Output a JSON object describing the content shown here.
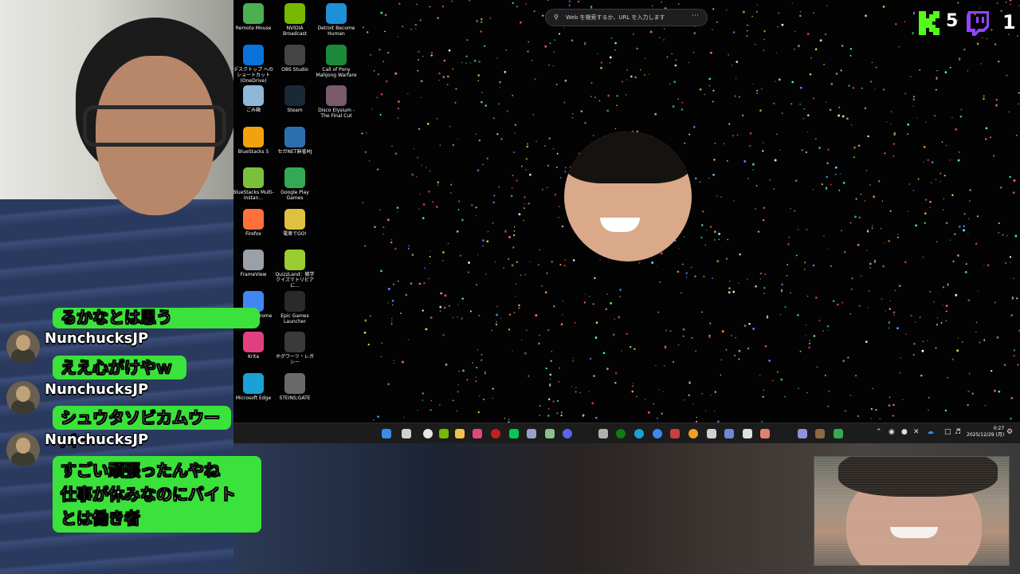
{
  "desktop": {
    "search_placeholder": "Web を検索するか、URL を入力します",
    "icons": [
      {
        "label": "Remote Mouse",
        "color": "#4caf50"
      },
      {
        "label": "NVIDIA Broadcast",
        "color": "#76b900"
      },
      {
        "label": "Detroit Become Human",
        "color": "#1f8fd6"
      },
      {
        "label": "デスクトップ への ショートカット (OneDrive)",
        "color": "#0a73d9"
      },
      {
        "label": "OBS Studio",
        "color": "#444444"
      },
      {
        "label": "Call of Pony Mahjong Warfare",
        "color": "#1a8a3a"
      },
      {
        "label": "ごみ箱",
        "color": "#8fb7d8"
      },
      {
        "label": "Steam",
        "color": "#1b2838"
      },
      {
        "label": "Disco Elysium - The Final Cut",
        "color": "#7a5a6a"
      },
      {
        "label": "BlueStacks 5",
        "color": "#f2a20f"
      },
      {
        "label": "セガNET麻雀MJ",
        "color": "#2c6fb0"
      },
      {
        "label": "BlueStacks Multi-Instan...",
        "color": "#7bbf3a"
      },
      {
        "label": "Google Play Games",
        "color": "#34a853"
      },
      {
        "label": "Firefox",
        "color": "#ff7139"
      },
      {
        "label": "電車でGO!",
        "color": "#e0c040"
      },
      {
        "label": "FrameView",
        "color": "#9aa0a8"
      },
      {
        "label": "QuizzLand：雑学クイズでトリビアに...",
        "color": "#9acd32"
      },
      {
        "label": "Google Chrome",
        "color": "#4285f4"
      },
      {
        "label": "Epic Games Launcher",
        "color": "#2a2a2a"
      },
      {
        "label": "Krita",
        "color": "#e04080"
      },
      {
        "label": "ホグワーツ・レガシー",
        "color": "#3a3a3a"
      },
      {
        "label": "Microsoft Edge",
        "color": "#1ba0d8"
      },
      {
        "label": "STEINS;GATE",
        "color": "#6a6a6a"
      }
    ]
  },
  "taskbar": {
    "clock_time": "0:27",
    "clock_date": "2025/12/29 (月)"
  },
  "chat": {
    "messages": [
      {
        "kind": "text",
        "text": "るかなとは思う"
      },
      {
        "kind": "user",
        "name": "NunchucksJP"
      },
      {
        "kind": "text",
        "text": "ええ心がけやｗ"
      },
      {
        "kind": "user",
        "name": "NunchucksJP"
      },
      {
        "kind": "text",
        "text": "シュウタソビカムウーバー"
      },
      {
        "kind": "user",
        "name": "NunchucksJP"
      },
      {
        "kind": "text_multi",
        "lines": [
          "すごい頑張ったんやね",
          "仕事が休みなのにバイト",
          "とは働き者"
        ]
      }
    ]
  },
  "badges": {
    "kick_count": "5",
    "twitch_count": "1",
    "kick_color": "#53fc18",
    "twitch_color": "#9146ff"
  },
  "colors": {
    "chat_bubble": "#3be23b"
  }
}
